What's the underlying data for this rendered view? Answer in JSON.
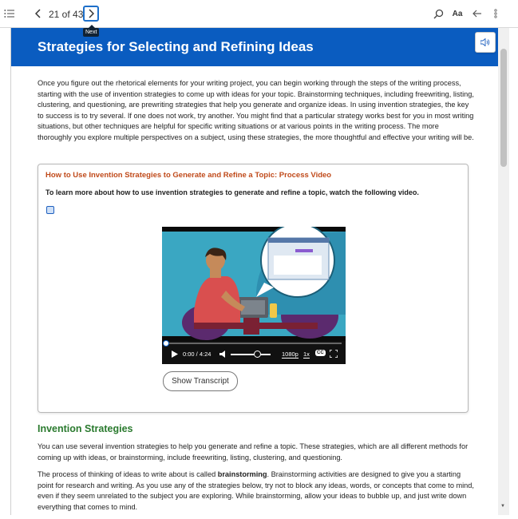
{
  "toolbar": {
    "page_indicator": "21 of 434",
    "next_tooltip": "Next",
    "font_label": "Aa"
  },
  "page": {
    "title": "Strategies for Selecting and Refining Ideas",
    "intro": "Once you figure out the rhetorical elements for your writing project, you can begin working through the steps of the writing process, starting with the use of invention strategies to come up with ideas for your topic. Brainstorming techniques, including freewriting, listing, clustering, and questioning, are prewriting strategies that help you generate and organize ideas. In using invention strategies, the key to success is to try several. If one does not work, try another. You might find that a particular strategy works best for you in most writing situations, but other techniques are helpful for specific writing situations or at various points in the writing process. The more thoroughly you explore multiple perspectives on a subject, using these strategies, the more thoughtful and effective your writing will be."
  },
  "video_box": {
    "title": "How to Use Invention Strategies to Generate and Refine a Topic: Process Video",
    "instruction": "To learn more about how to use invention strategies to generate and refine a topic, watch the following video.",
    "time": "0:00 / 4:24",
    "quality": "1080p",
    "speed": "1x",
    "cc": "CC",
    "progress": 0,
    "volume": 0.65,
    "transcript_label": "Show Transcript"
  },
  "section": {
    "heading": "Invention Strategies",
    "para1": "You can use several invention strategies to help you generate and refine a topic. These strategies, which are all different methods for coming up with ideas, or brainstorming, include freewriting, listing, clustering, and questioning.",
    "para2_before": "The process of thinking of ideas to write about is called ",
    "para2_bold": "brainstorming",
    "para2_after": ". Brainstorming activities are designed to give you a starting point for research and writing. As you use any of the strategies below, try not to block any ideas, words, or concepts that come to mind, even if they seem unrelated to the subject you are exploring. While brainstorming, allow your ideas to bubble up, and just write down everything that comes to mind."
  },
  "colors": {
    "banner": "#0a5cc0",
    "box_title": "#c04a1a",
    "heading": "#2a7a2e",
    "focus": "#1d6fc9"
  }
}
